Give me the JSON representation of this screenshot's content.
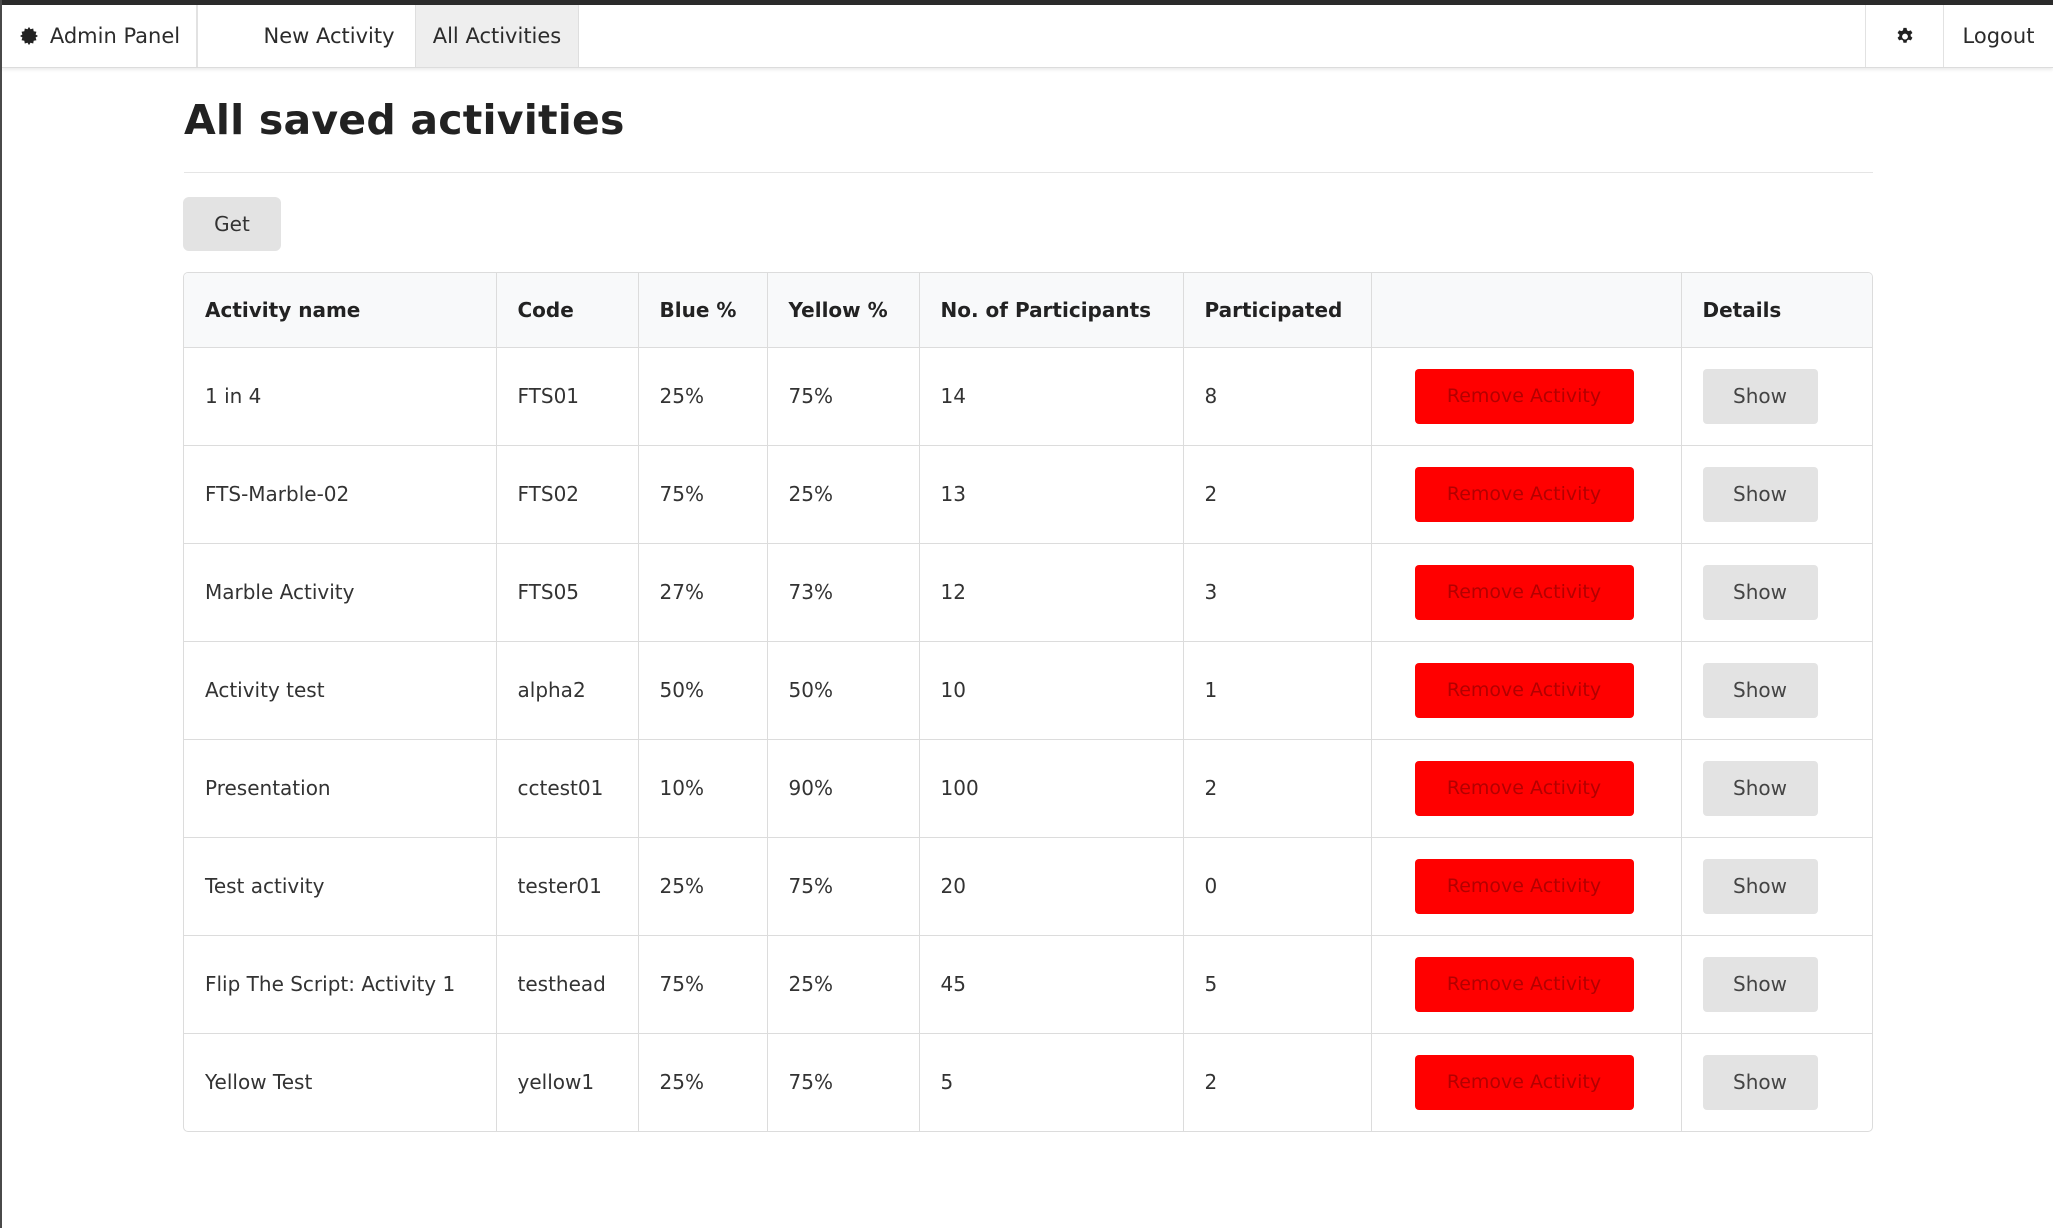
{
  "navbar": {
    "brand_label": "Admin Panel",
    "brand_icon": "gear-icon",
    "tabs": [
      {
        "label": "New Activity",
        "active": false
      },
      {
        "label": "All Activities",
        "active": true
      }
    ],
    "settings_icon": "gear-icon",
    "logout_label": "Logout"
  },
  "page": {
    "title": "All saved activities",
    "get_button_label": "Get"
  },
  "table": {
    "headers": [
      "Activity name",
      "Code",
      "Blue %",
      "Yellow %",
      "No. of Participants",
      "Participated",
      "",
      "Details"
    ],
    "remove_label": "Remove Activity",
    "show_label": "Show",
    "rows": [
      {
        "name": "1 in 4",
        "code": "FTS01",
        "blue": "25%",
        "yellow": "75%",
        "participants": "14",
        "participated": "8"
      },
      {
        "name": "FTS-Marble-02",
        "code": "FTS02",
        "blue": "75%",
        "yellow": "25%",
        "participants": "13",
        "participated": "2"
      },
      {
        "name": "Marble Activity",
        "code": "FTS05",
        "blue": "27%",
        "yellow": "73%",
        "participants": "12",
        "participated": "3"
      },
      {
        "name": "Activity test",
        "code": "alpha2",
        "blue": "50%",
        "yellow": "50%",
        "participants": "10",
        "participated": "1"
      },
      {
        "name": "Presentation",
        "code": "cctest01",
        "blue": "10%",
        "yellow": "90%",
        "participants": "100",
        "participated": "2"
      },
      {
        "name": "Test activity",
        "code": "tester01",
        "blue": "25%",
        "yellow": "75%",
        "participants": "20",
        "participated": "0"
      },
      {
        "name": "Flip The Script: Activity 1",
        "code": "testhead",
        "blue": "75%",
        "yellow": "25%",
        "participants": "45",
        "participated": "5"
      },
      {
        "name": "Yellow Test",
        "code": "yellow1",
        "blue": "25%",
        "yellow": "75%",
        "participants": "5",
        "participated": "2"
      }
    ]
  },
  "colors": {
    "remove_button_bg": "#ff0000",
    "remove_button_text": "#b30000",
    "neutral_button_bg": "#e3e3e3",
    "active_tab_bg": "#eeeeee"
  }
}
